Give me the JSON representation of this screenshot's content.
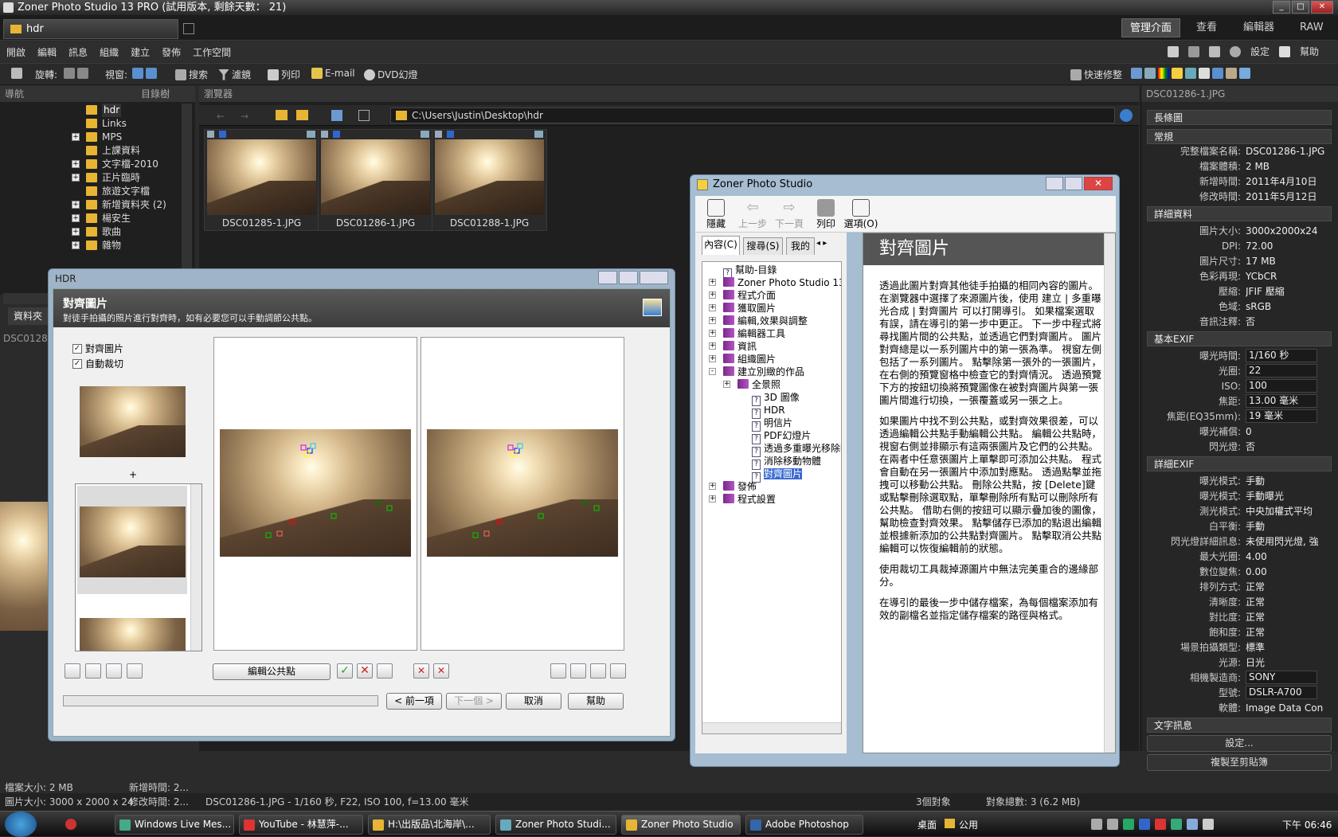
{
  "app": {
    "title": "Zoner Photo Studio 13 PRO (試用版本, 剩餘天數： 21)",
    "doc_tab": "hdr",
    "modes": [
      "管理介面",
      "查看",
      "編輯器",
      "RAW"
    ]
  },
  "menu": [
    "開啟",
    "編輯",
    "訊息",
    "組織",
    "建立",
    "發佈",
    "工作空間"
  ],
  "toolbar": {
    "rotate": "旋轉:",
    "view": "視窗:",
    "search": "搜索",
    "filter": "濾鏡",
    "print": "列印",
    "email": "E-mail",
    "dvd": "DVD幻燈",
    "quick_fix": "快速修整",
    "settings": "設定",
    "help": "幫助"
  },
  "nav": {
    "header": "導航",
    "dropdown": "目錄樹",
    "folders": [
      {
        "name": "hdr",
        "expand": false,
        "selected": true
      },
      {
        "name": "Links",
        "expand": false
      },
      {
        "name": "MPS",
        "expand": true
      },
      {
        "name": "上課資料",
        "expand": false
      },
      {
        "name": "文字檔-2010",
        "expand": true
      },
      {
        "name": "正片臨時",
        "expand": true
      },
      {
        "name": "旅遊文字檔",
        "expand": false
      },
      {
        "name": "新增資料夾 (2)",
        "expand": true
      },
      {
        "name": "楊安生",
        "expand": true
      },
      {
        "name": "歌曲",
        "expand": true
      },
      {
        "name": "雜物",
        "expand": true
      }
    ],
    "tab_label": "資料夾",
    "preview_label": "DSC0128"
  },
  "browser": {
    "header": "瀏覽器",
    "path": "C:\\Users\\Justin\\Desktop\\hdr",
    "thumbs": [
      "DSC01285-1.JPG",
      "DSC01286-1.JPG",
      "DSC01288-1.JPG"
    ]
  },
  "hdr_dialog": {
    "title": "HDR",
    "heading": "對齊圖片",
    "desc": "對徒手拍攝的照片進行對齊時，如有必要您可以手動調節公共點。",
    "align_label": "對齊圖片",
    "autocrop_label": "自動裁切",
    "plus": "+",
    "edit_points": "編輯公共點",
    "prev": "< 前一項",
    "next": "下一個 >",
    "cancel": "取消",
    "help": "幫助"
  },
  "help_window": {
    "title": "Zoner Photo Studio",
    "tools": [
      "隱藏",
      "上一步",
      "下一頁",
      "列印",
      "選項(O)"
    ],
    "tabs": [
      "內容(C)",
      "搜尋(S)",
      "我的"
    ],
    "toc": [
      {
        "label": "幫助-目錄",
        "type": "page",
        "level": 0
      },
      {
        "label": "Zoner Photo Studio 13",
        "type": "book",
        "level": 0,
        "exp": "+"
      },
      {
        "label": "程式介面",
        "type": "book",
        "level": 0,
        "exp": "+"
      },
      {
        "label": "獲取圖片",
        "type": "book",
        "level": 0,
        "exp": "+"
      },
      {
        "label": "編輯,效果與調整",
        "type": "book",
        "level": 0,
        "exp": "+"
      },
      {
        "label": "編輯器工具",
        "type": "book",
        "level": 0,
        "exp": "+"
      },
      {
        "label": "資訊",
        "type": "book",
        "level": 0,
        "exp": "+"
      },
      {
        "label": "組織圖片",
        "type": "book",
        "level": 0,
        "exp": "+"
      },
      {
        "label": "建立別緻的作品",
        "type": "book",
        "level": 0,
        "exp": "-"
      },
      {
        "label": "全景照",
        "type": "book",
        "level": 1,
        "exp": "+"
      },
      {
        "label": "3D 圖像",
        "type": "page",
        "level": 2
      },
      {
        "label": "HDR",
        "type": "page",
        "level": 2
      },
      {
        "label": "明信片",
        "type": "page",
        "level": 2
      },
      {
        "label": "PDF幻燈片",
        "type": "page",
        "level": 2
      },
      {
        "label": "透過多重曝光移除噪",
        "type": "page",
        "level": 2
      },
      {
        "label": "消除移動物體",
        "type": "page",
        "level": 2
      },
      {
        "label": "對齊圖片",
        "type": "page",
        "level": 2,
        "selected": true
      },
      {
        "label": "發佈",
        "type": "book",
        "level": 0,
        "exp": "+"
      },
      {
        "label": "程式設置",
        "type": "book",
        "level": 0,
        "exp": "+"
      }
    ],
    "page_title": "對齊圖片",
    "paragraphs": [
      "透過此圖片對齊其他徒手拍攝的相同內容的圖片。 在瀏覽器中選擇了來源圖片後，使用 建立 | 多重曝光合成 | 對齊圖片 可以打開導引。 如果檔案選取有誤，請在導引的第一步中更正。 下一步中程式將尋找圖片間的公共點，並透過它們對齊圖片。 圖片對齊總是以一系列圖片中的第一張為準。 視窗左側包括了一系列圖片。 點擊除第一張外的一張圖片，在右側的預覽窗格中檢查它的對齊情況。 透過預覽下方的按鈕切換將預覽圖像在被對齊圖片與第一張圖片間進行切換，一張覆蓋或另一張之上。",
      "如果圖片中找不到公共點，或對齊效果很差，可以透過編輯公共點手動編輯公共點。 編輯公共點時，視窗右側並排顯示有這兩張圖片及它們的公共點。 在兩者中任意張圖片上單擊即可添加公共點。 程式會自動在另一張圖片中添加對應點。 透過點擊並拖拽可以移動公共點。 刪除公共點，按 [Delete]鍵或點擊刪除選取點，單擊刪除所有點可以刪除所有公共點。 借助右側的按鈕可以顯示疊加後的圖像，幫助檢查對齊效果。 點擊儲存已添加的點退出編輯並根據新添加的公共點對齊圖片。 點擊取消公共點編輯可以恢復編輯前的狀態。",
      "使用裁切工具裁掉源圖片中無法完美重合的邊緣部分。",
      "在導引的最後一步中儲存檔案，為每個檔案添加有效的副檔名並指定儲存檔案的路徑與格式。"
    ]
  },
  "info_panel": {
    "filename_header": "DSC01286-1.JPG",
    "sections": {
      "long": "長條圖",
      "general": "常規",
      "details": "詳細資料",
      "basic_exif": "基本EXIF",
      "detail_exif": "詳細EXIF",
      "text_info": "文字訊息"
    },
    "general": [
      {
        "k": "完整檔案名稱:",
        "v": "DSC01286-1.JPG"
      },
      {
        "k": "檔案體積:",
        "v": "2 MB"
      },
      {
        "k": "新增時間:",
        "v": "2011年4月10日"
      },
      {
        "k": "修改時間:",
        "v": "2011年5月12日"
      }
    ],
    "details": [
      {
        "k": "圖片大小:",
        "v": "3000x2000x24"
      },
      {
        "k": "DPI:",
        "v": "72.00"
      },
      {
        "k": "圖片尺寸:",
        "v": "17 MB"
      },
      {
        "k": "色彩再現:",
        "v": "YCbCR"
      },
      {
        "k": "壓縮:",
        "v": "JFIF 壓縮"
      },
      {
        "k": "色域:",
        "v": "sRGB"
      },
      {
        "k": "音訊注釋:",
        "v": "否"
      }
    ],
    "basic_exif": [
      {
        "k": "曝光時間:",
        "v": "1/160 秒",
        "box": true
      },
      {
        "k": "光圈:",
        "v": "22",
        "box": true
      },
      {
        "k": "ISO:",
        "v": "100",
        "box": true
      },
      {
        "k": "焦距:",
        "v": "13.00 毫米",
        "box": true
      },
      {
        "k": "焦距(EQ35mm):",
        "v": "19 毫米",
        "box": true
      },
      {
        "k": "曝光補償:",
        "v": "0"
      },
      {
        "k": "閃光燈:",
        "v": "否"
      }
    ],
    "detail_exif": [
      {
        "k": "曝光模式:",
        "v": "手動"
      },
      {
        "k": "曝光模式:",
        "v": "手動曝光"
      },
      {
        "k": "測光模式:",
        "v": "中央加權式平均"
      },
      {
        "k": "白平衡:",
        "v": "手動"
      },
      {
        "k": "閃光燈詳細訊息:",
        "v": "未使用閃光燈, 強"
      },
      {
        "k": "最大光圈:",
        "v": "4.00"
      },
      {
        "k": "數位變焦:",
        "v": "0.00"
      },
      {
        "k": "排列方式:",
        "v": "正常"
      },
      {
        "k": "清晰度:",
        "v": "正常"
      },
      {
        "k": "對比度:",
        "v": "正常"
      },
      {
        "k": "飽和度:",
        "v": "正常"
      },
      {
        "k": "場景拍攝類型:",
        "v": "標準"
      },
      {
        "k": "光源:",
        "v": "日光"
      },
      {
        "k": "相機製造商:",
        "v": "SONY",
        "box": true
      },
      {
        "k": "型號:",
        "v": "DSLR-A700",
        "box": true
      },
      {
        "k": "軟體:",
        "v": "Image Data Con"
      }
    ],
    "settings_btn": "設定...",
    "copy_btn": "複製至剪貼簿"
  },
  "status": {
    "left1": "檔案大小: 2 MB",
    "left2": "圖片大小: 3000 x 2000 x 24",
    "added": "新增時間: 2...",
    "modified": "修改時間: 2...",
    "main": "DSC01286-1.JPG - 1/160 秒, F22, ISO 100, f=13.00 毫米",
    "count": "3個對象",
    "total": "對象總數: 3 (6.2 MB)"
  },
  "taskbar": {
    "items": [
      "Windows Live Mes...",
      "YouTube - 林慧萍-...",
      "H:\\出版品\\北海岸\\...",
      "Zoner Photo Studi...",
      "Zoner Photo Studio",
      "Adobe Photoshop"
    ],
    "desktop": "桌面",
    "public": "公用",
    "clock": "下午 06:46"
  },
  "colors": {
    "accent": "#e7b533",
    "bg": "#2b2b2b"
  }
}
